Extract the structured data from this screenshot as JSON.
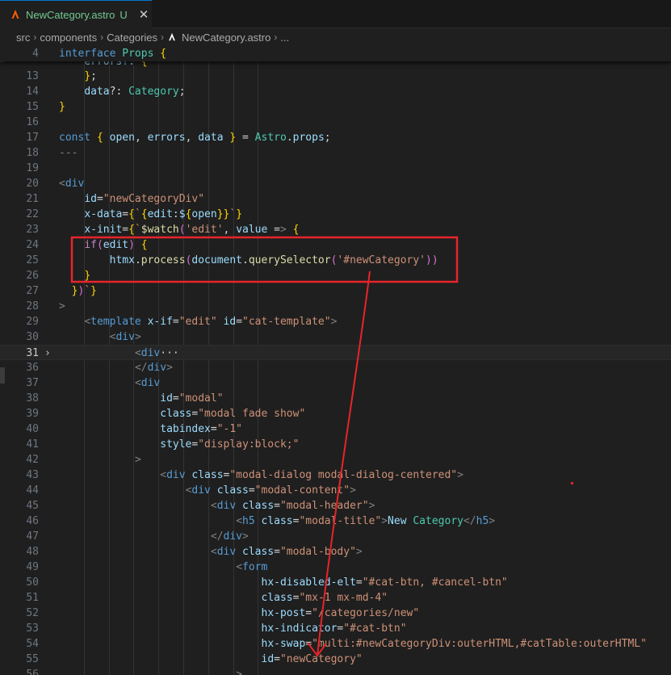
{
  "tab": {
    "filename": "NewCategory.astro",
    "status": "U",
    "close": "✕"
  },
  "breadcrumb": [
    "src",
    "components",
    "Categories",
    "NewCategory.astro",
    "..."
  ],
  "sticky": {
    "num": "4",
    "text": "interface Props {"
  },
  "lines": [
    {
      "num": "13",
      "text": "    };"
    },
    {
      "num": "14",
      "text": "    data?: Category;"
    },
    {
      "num": "15",
      "text": "}"
    },
    {
      "num": "16",
      "text": ""
    },
    {
      "num": "17",
      "text": "const { open, errors, data } = Astro.props;"
    },
    {
      "num": "18",
      "text": "---"
    },
    {
      "num": "19",
      "text": ""
    },
    {
      "num": "20",
      "text": "<div"
    },
    {
      "num": "21",
      "text": "    id=\"newCategoryDiv\""
    },
    {
      "num": "22",
      "text": "    x-data={`{edit:${open}}`}"
    },
    {
      "num": "23",
      "text": "    x-init={`$watch('edit', value => {"
    },
    {
      "num": "24",
      "text": "    if(edit) {"
    },
    {
      "num": "25",
      "text": "        htmx.process(document.querySelector('#newCategory'))"
    },
    {
      "num": "26",
      "text": "    }"
    },
    {
      "num": "27",
      "text": "  })`}"
    },
    {
      "num": "28",
      "text": ">"
    },
    {
      "num": "29",
      "text": "    <template x-if=\"edit\" id=\"cat-template\">"
    },
    {
      "num": "30",
      "text": "        <div>"
    },
    {
      "num": "31",
      "text": "            <div···"
    },
    {
      "num": "36",
      "text": "            </div>"
    },
    {
      "num": "37",
      "text": "            <div"
    },
    {
      "num": "38",
      "text": "                id=\"modal\""
    },
    {
      "num": "39",
      "text": "                class=\"modal fade show\""
    },
    {
      "num": "40",
      "text": "                tabindex=\"-1\""
    },
    {
      "num": "41",
      "text": "                style=\"display:block;\""
    },
    {
      "num": "42",
      "text": "            >"
    },
    {
      "num": "43",
      "text": "                <div class=\"modal-dialog modal-dialog-centered\">"
    },
    {
      "num": "44",
      "text": "                    <div class=\"modal-content\">"
    },
    {
      "num": "45",
      "text": "                        <div class=\"modal-header\">"
    },
    {
      "num": "46",
      "text": "                            <h5 class=\"modal-title\">New Category</h5>"
    },
    {
      "num": "47",
      "text": "                        </div>"
    },
    {
      "num": "48",
      "text": "                        <div class=\"modal-body\">"
    },
    {
      "num": "49",
      "text": "                            <form"
    },
    {
      "num": "50",
      "text": "                                hx-disabled-elt=\"#cat-btn, #cancel-btn\""
    },
    {
      "num": "51",
      "text": "                                class=\"mx-1 mx-md-4\""
    },
    {
      "num": "52",
      "text": "                                hx-post=\"/categories/new\""
    },
    {
      "num": "53",
      "text": "                                hx-indicator=\"#cat-btn\""
    },
    {
      "num": "54",
      "text": "                                hx-swap=\"multi:#newCategoryDiv:outerHTML,#catTable:outerHTML\""
    },
    {
      "num": "55",
      "text": "                                id=\"newCategory\""
    },
    {
      "num": "56",
      "text": "                            >"
    }
  ],
  "colors": {
    "annotation": "#e8242a",
    "tab_label": "#73c991",
    "editor_bg": "#1f1f1f"
  }
}
